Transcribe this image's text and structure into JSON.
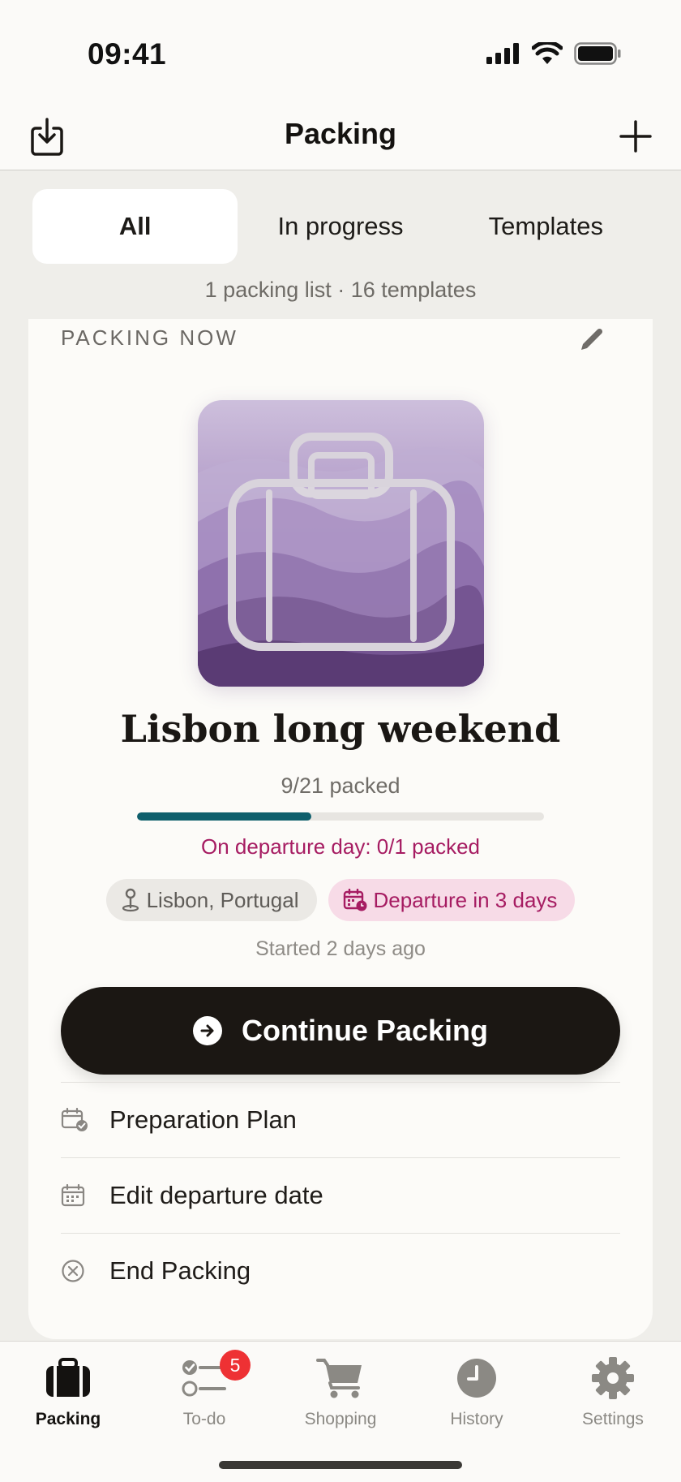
{
  "status_bar": {
    "time": "09:41"
  },
  "nav": {
    "title": "Packing"
  },
  "segments": [
    {
      "label": "All",
      "active": true
    },
    {
      "label": "In progress",
      "active": false
    },
    {
      "label": "Templates",
      "active": false
    }
  ],
  "counts_text": "1 packing list · 16 templates",
  "card": {
    "section_label": "PACKING NOW",
    "title": "Lisbon long weekend",
    "packed_text": "9/21 packed",
    "progress": {
      "packed": 9,
      "total": 21
    },
    "departure_day_text": "On departure day: 0/1 packed",
    "location": "Lisbon, Portugal",
    "departure": "Departure in 3 days",
    "started": "Started 2 days ago",
    "continue_label": "Continue Packing",
    "actions": [
      {
        "label": "Preparation Plan",
        "icon": "calendar-check-icon"
      },
      {
        "label": "Edit departure date",
        "icon": "calendar-icon"
      },
      {
        "label": "End Packing",
        "icon": "x-circle-icon"
      }
    ]
  },
  "tabs": [
    {
      "label": "Packing",
      "icon": "suitcase-icon",
      "active": true
    },
    {
      "label": "To-do",
      "icon": "checklist-icon",
      "badge": "5"
    },
    {
      "label": "Shopping",
      "icon": "cart-icon"
    },
    {
      "label": "History",
      "icon": "clock-icon"
    },
    {
      "label": "Settings",
      "icon": "gear-icon"
    }
  ],
  "colors": {
    "accent_teal": "#0f5f6c",
    "accent_magenta": "#a61c62",
    "badge_red": "#ee3134",
    "button_dark": "#1b1713"
  }
}
